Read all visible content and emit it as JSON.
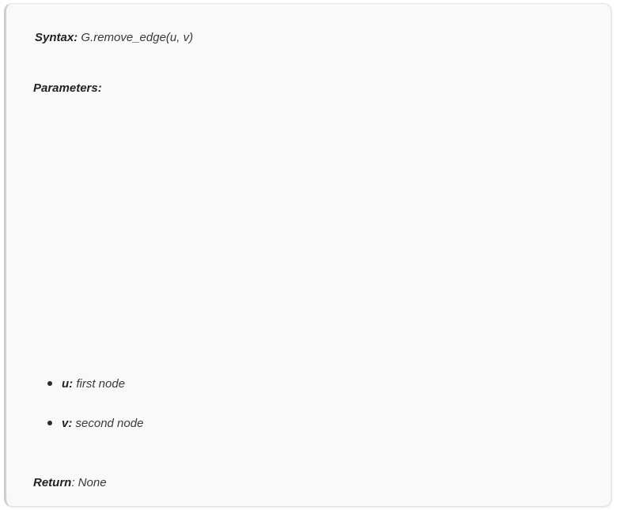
{
  "syntax": {
    "label": "Syntax:",
    "value": "G.remove_edge(u, v)"
  },
  "parameters": {
    "label": "Parameters:",
    "items": [
      {
        "name": "u:",
        "description": "first node"
      },
      {
        "name": "v:",
        "description": "second node"
      }
    ]
  },
  "return": {
    "label": "Return",
    "value": ": None"
  }
}
